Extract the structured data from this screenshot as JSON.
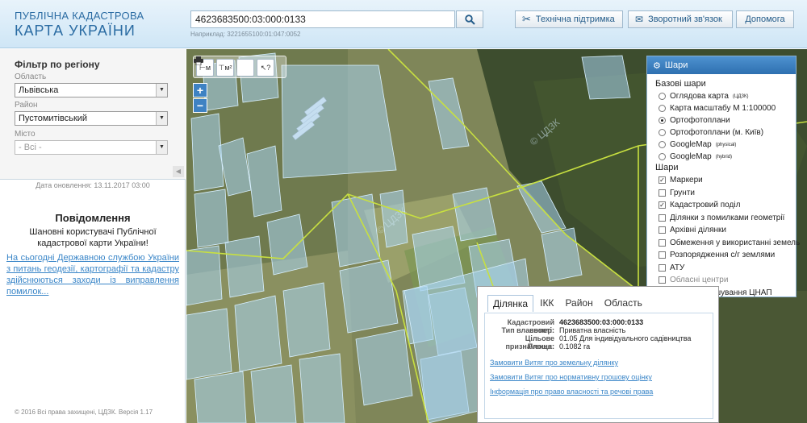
{
  "header": {
    "logo_top": "ПУБЛІЧНА КАДАСТРОВА",
    "logo_bottom": "КАРТА УКРАЇНИ",
    "search_value": "4623683500:03:000:0133",
    "search_hint": "Наприклад: 3221655100:01:047:0052",
    "support_label": "Технічна підтримка",
    "feedback_label": "Зворотний зв'язок",
    "help_label": "Допомога"
  },
  "filter": {
    "title": "Фільтр по регіону",
    "oblast_label": "Область",
    "oblast_value": "Львівська",
    "raion_label": "Район",
    "raion_value": "Пустомитівський",
    "misto_label": "Місто",
    "misto_value": "- Всі -"
  },
  "sidebar": {
    "update_date": "Дата оновлення: 13.11.2017 03:00",
    "message_title": "Повідомлення",
    "message_text": "Шановні користувачі Публічної кадастрової карти України!",
    "message_link": "На сьогодні Державною службою України з питань геодезії, картографії та кадастру здійснюються заходи із виправлення помилок...",
    "footer": "© 2016 Всі права захищені, ЦДЗК. Версія 1.17"
  },
  "map": {
    "tools": [
      "⊢м",
      "⊤м²",
      "print",
      "cursor-help"
    ],
    "zoom_in": "+",
    "zoom_out": "−"
  },
  "layers": {
    "title": "Шари",
    "base_title": "Базові шари",
    "base": [
      {
        "label": "Оглядова карта",
        "sup": "(ЦДЗК)",
        "on": false
      },
      {
        "label": "Карта масштабу М 1:100000",
        "sup": "",
        "on": false
      },
      {
        "label": "Ортофотоплани",
        "sup": "",
        "on": true
      },
      {
        "label": "Ортофотоплани (м. Київ)",
        "sup": "",
        "on": false
      },
      {
        "label": "GoogleMap",
        "sup": "(physical)",
        "on": false
      },
      {
        "label": "GoogleMap",
        "sup": "(hybrid)",
        "on": false
      }
    ],
    "layers_title": "Шари",
    "items": [
      {
        "label": "Маркери",
        "checked": true,
        "dim": false
      },
      {
        "label": "Грунти",
        "checked": false,
        "dim": false
      },
      {
        "label": "Кадастровий поділ",
        "checked": true,
        "dim": false
      },
      {
        "label": "Ділянки з помилками геометрії",
        "checked": false,
        "dim": false
      },
      {
        "label": "Архівні ділянки",
        "checked": false,
        "dim": false
      },
      {
        "label": "Обмеження у використанні земель",
        "checked": false,
        "dim": false
      },
      {
        "label": "Розпорядження с/г землями",
        "checked": false,
        "dim": false
      },
      {
        "label": "АТУ",
        "checked": false,
        "dim": false
      },
      {
        "label": "Обласні центри",
        "checked": false,
        "dim": true
      },
      {
        "label": "Місце розташування ЦНАП",
        "checked": false,
        "dim": false
      }
    ]
  },
  "popup": {
    "tabs": [
      "Ділянка",
      "ІКК",
      "Район",
      "Область"
    ],
    "fields": [
      {
        "label": "Кадастровий номер:",
        "value": "4623683500:03:000:0133"
      },
      {
        "label": "Тип власності:",
        "value": "Приватна власність"
      },
      {
        "label": "Цільове призначення:",
        "value": "01.05 Для індивідуального садівництва"
      },
      {
        "label": "Площа:",
        "value": "0.1082 га"
      }
    ],
    "links": [
      "Замовити Витяг про земельну ділянку",
      "Замовити Витяг про нормативну грошову оцінку",
      "Інформація про право власності та речові права"
    ]
  },
  "colors": {
    "accent": "#2e70b0",
    "parcel_fill": "#a8d4f0",
    "boundary_line": "#c8e040"
  }
}
